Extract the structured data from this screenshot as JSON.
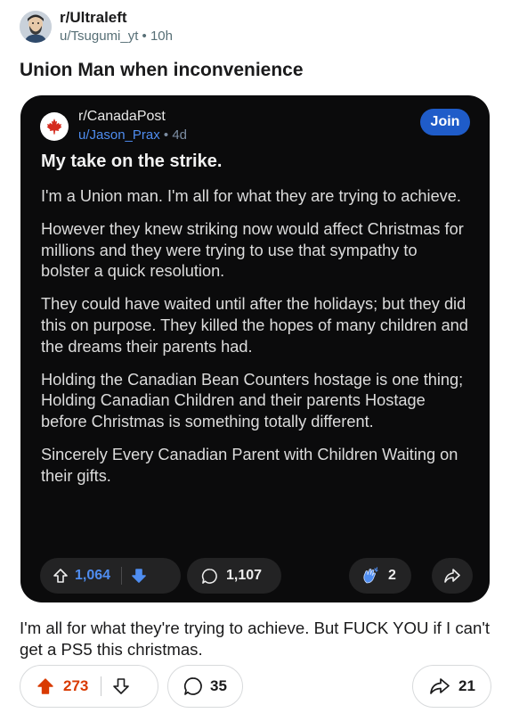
{
  "post": {
    "subreddit": "r/Ultraleft",
    "user_line": "u/Tsugumi_yt • 10h",
    "title": "Union Man when inconvenience",
    "caption": "I'm all for what they're trying to achieve. But FUCK YOU if I can't get a PS5 this christmas.",
    "actions": {
      "upvotes": "273",
      "comments": "35",
      "shares": "21"
    },
    "colors": {
      "upvoted": "#d93a00"
    }
  },
  "embedded": {
    "subreddit": "r/CanadaPost",
    "author": "u/Jason_Prax",
    "age": "• 4d",
    "join_label": "Join",
    "title": "My take on the strike.",
    "paragraphs": [
      "I'm a Union man. I'm all for what they are trying to achieve.",
      "However they knew striking now would affect Christmas for millions and they were trying to use that sympathy to bolster  a quick resolution.",
      "They could have waited until after the holidays; but they did this on purpose. They killed the hopes of many children and the dreams their parents had.",
      "Holding the Canadian Bean Counters hostage is one thing; Holding Canadian Children and their parents Hostage before Christmas is something totally different.",
      "Sincerely Every Canadian Parent with Children Waiting on their gifts."
    ],
    "actions": {
      "upvotes": "1,064",
      "comments": "1,107",
      "awards": "2"
    },
    "colors": {
      "accent": "#4f8df0",
      "join": "#1f5cc9",
      "card_bg": "#0b0b0c"
    }
  },
  "icons": {
    "outer_avatar": "cartoon-portrait-avatar",
    "embedded_avatar": "maple-leaf-icon",
    "upvote": "arrow-up-icon",
    "downvote": "arrow-down-icon",
    "comment": "speech-bubble-icon",
    "award": "clapping-hands-icon",
    "share": "share-arrow-icon"
  }
}
